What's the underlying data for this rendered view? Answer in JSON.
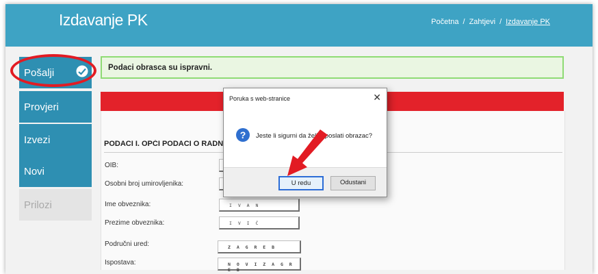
{
  "header": {
    "title": "Izdavanje PK",
    "breadcrumb": [
      "Početna",
      "Zahtjevi",
      "Izdavanje PK"
    ],
    "bg_color": "#3ea3c4"
  },
  "sidebar": {
    "items": [
      {
        "label": "Pošalji",
        "icon": "send-icon"
      },
      {
        "label": "Provjeri"
      },
      {
        "label": "Izvezi"
      },
      {
        "label": "Novi"
      },
      {
        "label": "Prilozi",
        "disabled": true
      }
    ],
    "highlight_color": "#e21b23"
  },
  "alert": {
    "text": "Podaci obrasca su ispravni.",
    "color": "#8edb74"
  },
  "form": {
    "section_title": "PODACI I. OPĆI PODACI O RADNIKU/OSIGURANIKU",
    "fields": [
      {
        "label": "OIB:",
        "value": ""
      },
      {
        "label": "Osobni broj umirovljenika:",
        "value": ""
      },
      {
        "label": "Ime obveznika:",
        "value": "I V A N"
      },
      {
        "label": "Prezime obveznika:",
        "value": "I V I Ć"
      },
      {
        "label": "Područni ured:",
        "value": "Z A G R E B"
      },
      {
        "label": "Ispostava:",
        "value": "N O V I  Z A G R E B"
      }
    ]
  },
  "dialog": {
    "title": "Poruka s web-stranice",
    "message": "Jeste li sigurni da želite poslati obrazac?",
    "ok_label": "U redu",
    "cancel_label": "Odustani",
    "icon": "question-icon"
  },
  "annotation": {
    "arrow_color": "#e21b23"
  }
}
